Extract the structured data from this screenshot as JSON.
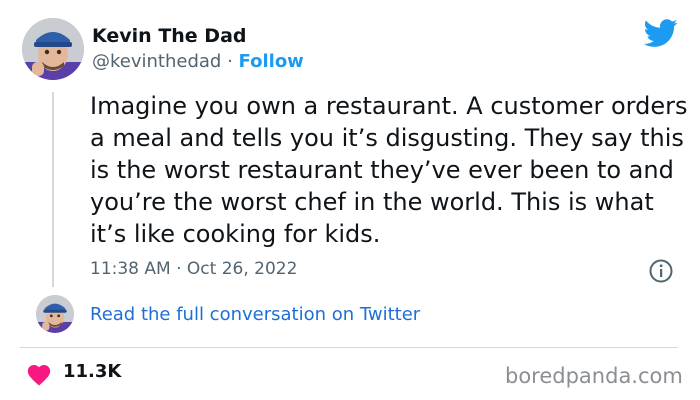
{
  "author": {
    "display_name": "Kevin The Dad",
    "handle": "@kevinthedad",
    "separator": "·",
    "follow_label": "Follow"
  },
  "tweet": {
    "text": "Imagine you own a restaurant. A customer orders a meal and tells you it’s disgusting. They say this is the worst restaurant they’ve ever been to and you’re the worst chef in the world. This is what it’s like cooking for kids.",
    "timestamp": "11:38 AM · Oct 26, 2022"
  },
  "conversation_link": "Read the full conversation on Twitter",
  "likes": {
    "count": "11.3K"
  },
  "watermark": "boredpanda.com",
  "icons": {
    "brand": "twitter-bird-icon",
    "info": "info-icon",
    "like": "heart-icon"
  },
  "colors": {
    "twitter_blue": "#1d9bf0",
    "link_blue": "#1d6fd6",
    "heart_pink": "#f91880",
    "secondary_text": "#536471"
  }
}
